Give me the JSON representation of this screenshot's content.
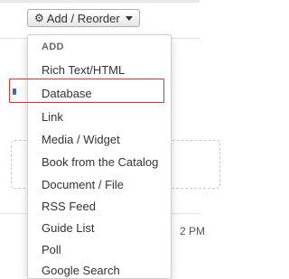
{
  "toolbar": {
    "add_reorder_label": "Add / Reorder",
    "gear_icon": "gear-icon",
    "caret_icon": "caret-down-icon"
  },
  "dropdown": {
    "header": "ADD",
    "items": [
      {
        "label": "Rich Text/HTML"
      },
      {
        "label": "Database",
        "highlighted": true
      },
      {
        "label": "Link"
      },
      {
        "label": "Media / Widget"
      },
      {
        "label": "Book from the Catalog"
      },
      {
        "label": "Document / File"
      },
      {
        "label": "RSS Feed"
      },
      {
        "label": "Guide List"
      },
      {
        "label": "Poll"
      },
      {
        "label": "Google Search"
      }
    ]
  },
  "background": {
    "partial_time_text": "2 PM"
  },
  "colors": {
    "highlight_border": "#e23232",
    "marker_blue": "#3a6db5"
  }
}
